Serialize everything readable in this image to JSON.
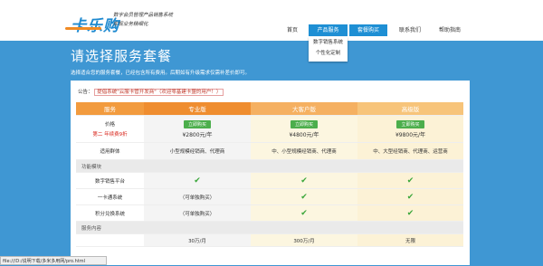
{
  "header": {
    "logo": "卡乐购",
    "slogan_line1": "数字会员管理产品销售系统",
    "slogan_line2": "实现业务精细化"
  },
  "nav": {
    "items": [
      "首页",
      "产品服务",
      "套餐购买",
      "联系我们",
      "帮助指南"
    ],
    "dropdown": [
      "数字销售系统",
      "个性化定制"
    ]
  },
  "hero": {
    "title": "请选择服务套餐",
    "subtitle": "选择适合您的服务套餐，已经包含所有费用。后期如有升级需求仅需补差价即可。"
  },
  "notice": {
    "label": "公告：",
    "text": "提倡系统\"云服卡管开发商\"（欢迎零基建卡盟的用户！）"
  },
  "table": {
    "headers": [
      "服务",
      "专业版",
      "大客户版",
      "高级版"
    ],
    "price_label": "价格",
    "price_note": "第二 年续费9折",
    "buy_label": "立即购买",
    "prices": [
      "¥2800元/年",
      "¥4800元/年",
      "¥9800元/年"
    ],
    "audience_label": "适用群体",
    "audience": [
      "小型规模经销商、代理商",
      "中、小型规模经销商、代理商",
      "中、大型经销商、代理商、运营商"
    ],
    "section_features": "功能模块",
    "features": [
      {
        "name": "数字销售平台",
        "values": [
          "✔",
          "✔",
          "✔"
        ]
      },
      {
        "name": "一卡通系统",
        "values": [
          "（可单独购买）",
          "✔",
          "✔"
        ]
      },
      {
        "name": "积分兑换系统",
        "values": [
          "（可单独购买）",
          "✔",
          "✔"
        ]
      }
    ],
    "section_service": "服务内容",
    "service_row": [
      "30万/月",
      "300万/月",
      "无限"
    ]
  },
  "statusbar": "file:///D:/说明下载/多米多用网/pro.html"
}
